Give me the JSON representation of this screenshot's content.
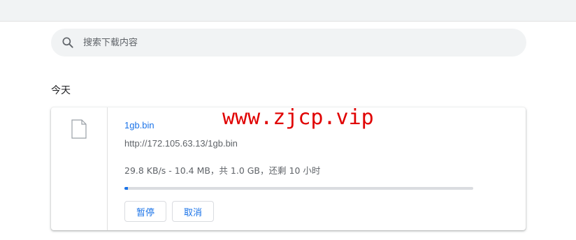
{
  "search": {
    "placeholder": "搜索下载内容",
    "icon": "search-icon"
  },
  "section": {
    "title": "今天"
  },
  "download": {
    "file_name": "1gb.bin",
    "url": "http://172.105.63.13/1gb.bin",
    "status": "29.8 KB/s - 10.4 MB，共 1.0 GB，还剩 10 小时",
    "progress_fraction": 0.01,
    "icon": "file-icon",
    "pause_label": "暂停",
    "cancel_label": "取消"
  },
  "watermark": "www.zjcp.vip",
  "colors": {
    "accent": "#1a73e8",
    "watermark": "#e00000",
    "track": "#dadce0"
  }
}
